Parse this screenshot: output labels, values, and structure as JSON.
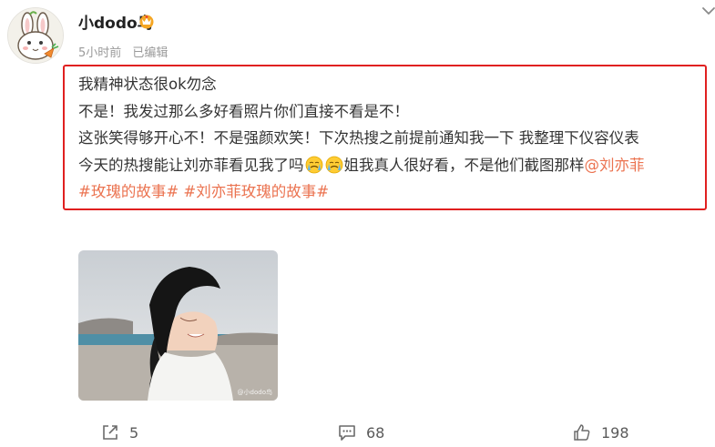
{
  "user": {
    "name": "小dodo鸟",
    "time": "5小时前",
    "edited": "已编辑"
  },
  "post": {
    "line1": "我精神状态很ok勿念",
    "line2": "不是！我发过那么多好看照片你们直接不看是不！",
    "line3": "这张笑得够开心不！不是强颜欢笑！下次热搜之前提前通知我一下 我整理下仪容仪表",
    "line4a": "今天的热搜能让刘亦菲看见我了吗",
    "line4b": "姐我真人很好看，不是他们截图那样",
    "mention": "@刘亦菲",
    "tag1": "#玫瑰的故事#",
    "tag2": "#刘亦菲玫瑰的故事#"
  },
  "photo": {
    "watermark": "@小dodo鸟"
  },
  "actions": {
    "share_count": "5",
    "comment_count": "68",
    "like_count": "198"
  },
  "colors": {
    "accent": "#eb7350",
    "highlight_border": "#e02020",
    "vip_badge": "#f5a623"
  },
  "icons": {
    "avatar": "rabbit-avatar",
    "vip": "vip-crown-icon",
    "menu": "chevron-down-icon",
    "emoji": "crying-face-emoji",
    "share": "share-icon",
    "comment": "comment-icon",
    "like": "thumbs-up-icon"
  }
}
